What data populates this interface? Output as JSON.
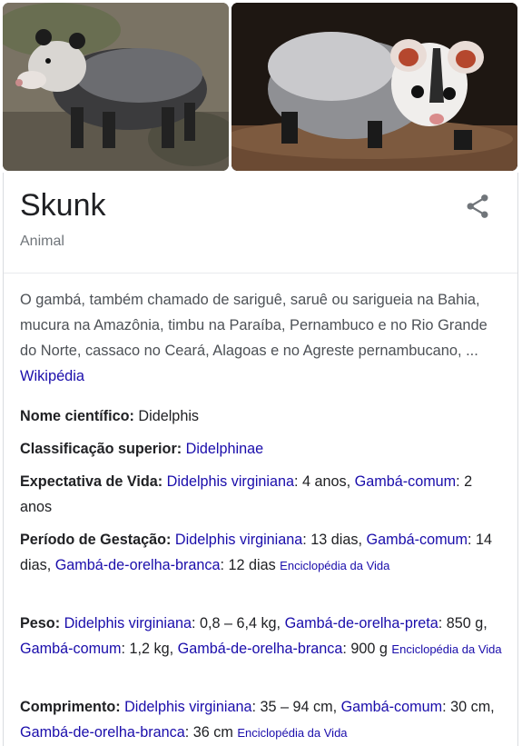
{
  "panel": {
    "title": "Skunk",
    "subtitle": "Animal",
    "description": "O gambá, também chamado de sariguê, saruê ou sarigueia na Bahia, mucura na Amazônia, timbu na Paraíba, Pernambuco e no Rio Grande do Norte, cassaco no Ceará, Alagoas e no Agreste pernambucano, ...",
    "description_link": "Wikipédia"
  },
  "facts": {
    "scientific_name": {
      "label": "Nome científico:",
      "value": "Didelphis"
    },
    "higher_classification": {
      "label": "Classificação superior:",
      "value": "Didelphinae"
    },
    "life_expectancy": {
      "label": "Expectativa de Vida:",
      "items": [
        {
          "name": "Didelphis virginiana",
          "value": ": 4 anos, "
        },
        {
          "name": "Gambá-comum",
          "value": ": 2 anos"
        }
      ]
    },
    "gestation": {
      "label": "Período de Gestação:",
      "items": [
        {
          "name": "Didelphis virginiana",
          "value": ": 13 dias, "
        },
        {
          "name": "Gambá-comum",
          "value": ": 14 dias, "
        },
        {
          "name": "Gambá-de-orelha-branca",
          "value": ": 12 dias "
        }
      ],
      "source": "Enciclopédia da Vida"
    },
    "weight": {
      "label": "Peso:",
      "items": [
        {
          "name": "Didelphis virginiana",
          "value": ": 0,8 – 6,4 kg, "
        },
        {
          "name": "Gambá-de-orelha-preta",
          "value": ": 850 g, "
        },
        {
          "name": "Gambá-comum",
          "value": ": 1,2 kg, "
        },
        {
          "name": "Gambá-de-orelha-branca",
          "value": ": 900 g "
        }
      ],
      "source": "Enciclopédia da Vida"
    },
    "length": {
      "label": "Comprimento:",
      "items": [
        {
          "name": "Didelphis virginiana",
          "value": ": 35 – 94 cm, "
        },
        {
          "name": "Gambá-comum",
          "value": ": 30 cm, "
        },
        {
          "name": "Gambá-de-orelha-branca",
          "value": ": 36 cm "
        }
      ],
      "source": "Enciclopédia da Vida"
    }
  },
  "icons": {
    "share": "share-icon"
  },
  "colors": {
    "link": "#1a0dab",
    "text": "#202124",
    "muted": "#70757a",
    "description": "#4d5156"
  }
}
